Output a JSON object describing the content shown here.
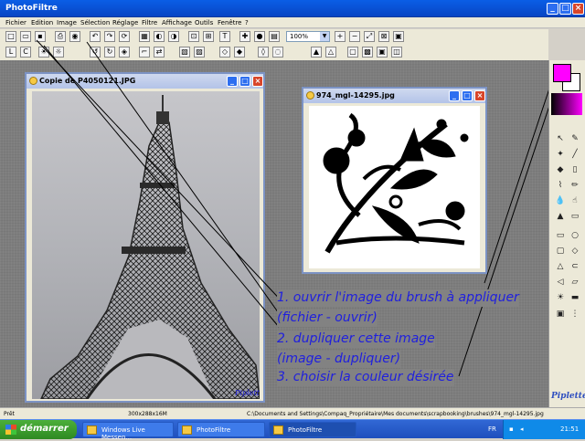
{
  "app": {
    "title": "PhotoFiltre"
  },
  "menu": [
    "Fichier",
    "Edition",
    "Image",
    "Sélection",
    "Réglage",
    "Filtre",
    "Affichage",
    "Outils",
    "Fenêtre",
    "?"
  ],
  "toolbar": {
    "zoom": "100%"
  },
  "windows": [
    {
      "title": "Copie de P4050121.JPG",
      "watermark": "Piplette"
    },
    {
      "title": "974_mgl-14295.jpg"
    }
  ],
  "instructions": [
    "1. ouvrir l'image du brush à appliquer",
    "(fichier - ouvrir)",
    "2. dupliquer cette image",
    "(image - dupliquer)",
    "3. choisir la couleur désirée"
  ],
  "signature": "Piplette",
  "status": {
    "left": "Prêt",
    "size": "300x288x16M",
    "path": "C:\\Documents and Settings\\Compaq_Propriétaire\\Mes documents\\scrapbooking\\brushes\\974_mgl-14295.jpg"
  },
  "colors": {
    "foreground": "#ff00ff",
    "background": "#ffffff"
  },
  "taskbar": {
    "start": "démarrer",
    "tasks": [
      "Windows Live Messen...",
      "PhotoFiltre",
      "PhotoFiltre"
    ],
    "lang": "FR",
    "clock": "21:51"
  }
}
